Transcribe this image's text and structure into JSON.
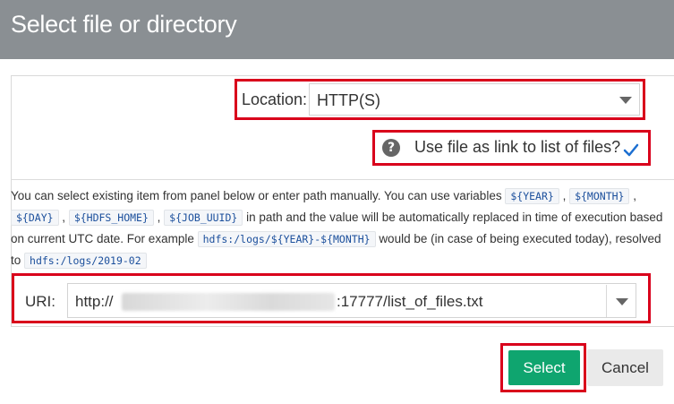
{
  "dialog": {
    "title": "Select file or directory"
  },
  "location": {
    "label": "Location:",
    "value": "HTTP(S)"
  },
  "link_option": {
    "label": "Use file as link to list of files?",
    "checked": true
  },
  "description": {
    "part1": "You can select existing item from panel below or enter path manually. You can use variables",
    "var_year": "${YEAR}",
    "var_month": "${MONTH}",
    "var_day": "${DAY}",
    "var_hdfs_home": "${HDFS_HOME}",
    "var_job_uuid": "${JOB_UUID}",
    "part2": "in path and the value will be automatically replaced in time of execution based on current UTC date. For example",
    "example_path": "hdfs:/logs/${YEAR}-${MONTH}",
    "part3": "would be (in case of being executed today), resolved to",
    "resolved_path": "hdfs:/logs/2019-02"
  },
  "uri": {
    "label": "URI:",
    "prefix": "http://",
    "suffix": ":17777/list_of_files.txt"
  },
  "buttons": {
    "select": "Select",
    "cancel": "Cancel"
  },
  "colors": {
    "titlebar": "#8a8f93",
    "highlight_border": "#d9001b",
    "select_button": "#0fa56f",
    "cancel_button": "#eaeaea",
    "checkmark": "#1c6fd1"
  },
  "icons": {
    "help": "question-circle-icon",
    "check": "checkmark-icon",
    "dropdown": "chevron-down-icon"
  }
}
